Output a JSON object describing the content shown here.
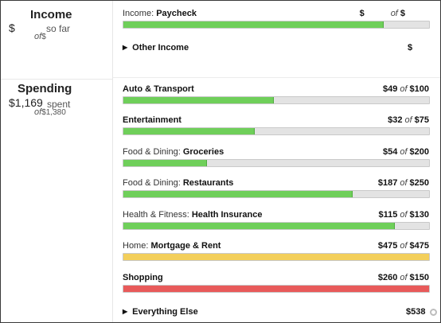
{
  "income": {
    "title": "Income",
    "amount": "$",
    "so_far": "so far",
    "of_text": "of",
    "of_amount": "$",
    "rows": [
      {
        "prefix": "Income: ",
        "name": "Paycheck",
        "actual": "$",
        "budget": "$",
        "progress_pct": 85,
        "color": "#6fcf5a"
      }
    ],
    "other": {
      "label": "Other Income",
      "amount": "$"
    }
  },
  "spending": {
    "title": "Spending",
    "amount": "$1,169",
    "spent": "spent",
    "of_text": "of",
    "of_amount": "$1,380",
    "rows": [
      {
        "prefix": "",
        "name": "Auto & Transport",
        "actual": "$49",
        "budget": "$100",
        "progress_pct": 49,
        "color": "#6fcf5a"
      },
      {
        "prefix": "",
        "name": "Entertainment",
        "actual": "$32",
        "budget": "$75",
        "progress_pct": 42.7,
        "color": "#6fcf5a"
      },
      {
        "prefix": "Food & Dining: ",
        "name": "Groceries",
        "actual": "$54",
        "budget": "$200",
        "progress_pct": 27,
        "color": "#6fcf5a"
      },
      {
        "prefix": "Food & Dining: ",
        "name": "Restaurants",
        "actual": "$187",
        "budget": "$250",
        "progress_pct": 74.8,
        "color": "#6fcf5a"
      },
      {
        "prefix": "Health & Fitness: ",
        "name": "Health Insurance",
        "actual": "$115",
        "budget": "$130",
        "progress_pct": 88.5,
        "color": "#6fcf5a"
      },
      {
        "prefix": "Home: ",
        "name": "Mortgage & Rent",
        "actual": "$475",
        "budget": "$475",
        "progress_pct": 100,
        "color": "#f3cf5b"
      },
      {
        "prefix": "",
        "name": "Shopping",
        "actual": "$260",
        "budget": "$150",
        "progress_pct": 100,
        "color": "#e85a5a"
      }
    ],
    "else": {
      "label": "Everything Else",
      "amount": "$538"
    }
  },
  "icons": {
    "expand": "triangle-right-icon",
    "settings": "gear-icon"
  }
}
